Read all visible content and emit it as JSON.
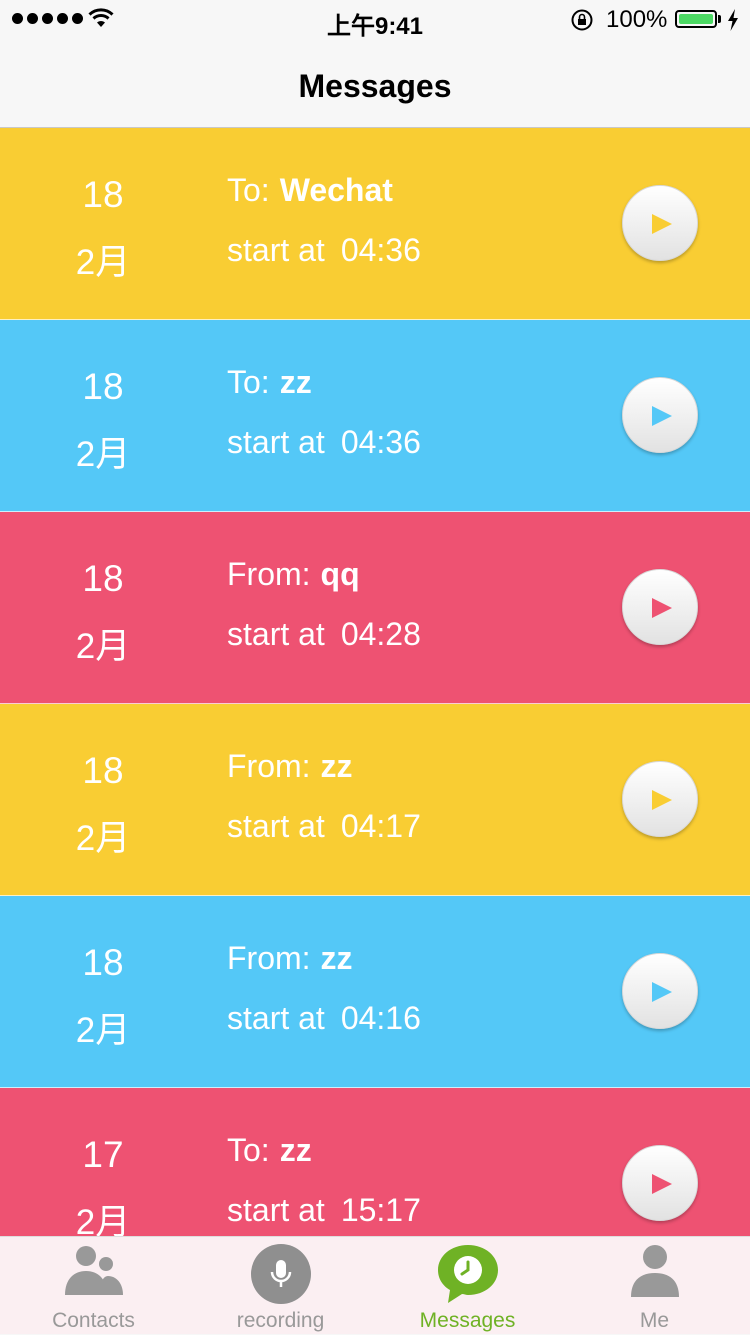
{
  "status_bar": {
    "time": "上午9:41",
    "battery_percent": "100%",
    "battery_level": 1.0
  },
  "nav": {
    "title": "Messages"
  },
  "messages": [
    {
      "day": "18",
      "month": "2月",
      "direction": "To:",
      "name": "Wechat",
      "start_label": "start at",
      "time": "04:36",
      "color": "#f9cd33",
      "arrow_color": "#f9cd33"
    },
    {
      "day": "18",
      "month": "2月",
      "direction": "To:",
      "name": "zz",
      "start_label": "start at",
      "time": "04:36",
      "color": "#54c8f7",
      "arrow_color": "#54c8f7"
    },
    {
      "day": "18",
      "month": "2月",
      "direction": "From:",
      "name": "qq",
      "start_label": "start at",
      "time": "04:28",
      "color": "#ee5272",
      "arrow_color": "#ee5272"
    },
    {
      "day": "18",
      "month": "2月",
      "direction": "From:",
      "name": "zz",
      "start_label": "start at",
      "time": "04:17",
      "color": "#f9cd33",
      "arrow_color": "#f9cd33"
    },
    {
      "day": "18",
      "month": "2月",
      "direction": "From:",
      "name": "zz",
      "start_label": "start at",
      "time": "04:16",
      "color": "#54c8f7",
      "arrow_color": "#54c8f7"
    },
    {
      "day": "17",
      "month": "2月",
      "direction": "To:",
      "name": "zz",
      "start_label": "start at",
      "time": "15:17",
      "color": "#ee5272",
      "arrow_color": "#ee5272"
    }
  ],
  "tabs": [
    {
      "label": "Contacts",
      "icon": "contacts-icon",
      "active": false
    },
    {
      "label": "recording",
      "icon": "microphone-icon",
      "active": false
    },
    {
      "label": "Messages",
      "icon": "messages-clock-icon",
      "active": true
    },
    {
      "label": "Me",
      "icon": "person-icon",
      "active": false
    }
  ],
  "colors": {
    "active_tab": "#6fb225",
    "inactive_tab": "#999999"
  }
}
